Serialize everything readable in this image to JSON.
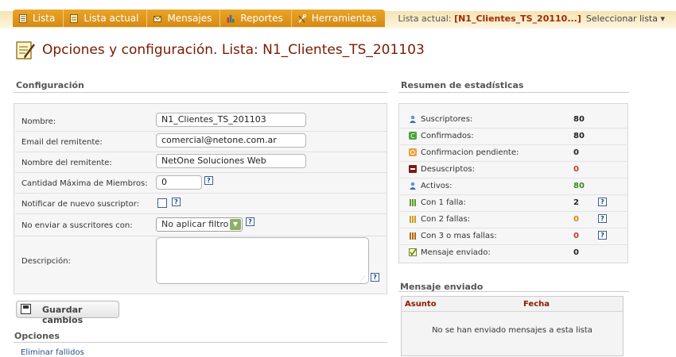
{
  "tabs": [
    {
      "label": "Lista",
      "icon": "list-icon"
    },
    {
      "label": "Lista actual",
      "icon": "document-icon"
    },
    {
      "label": "Mensajes",
      "icon": "envelope-icon"
    },
    {
      "label": "Reportes",
      "icon": "bar-chart-icon"
    },
    {
      "label": "Herramientas",
      "icon": "tools-icon"
    }
  ],
  "topright": {
    "prefix": "Lista actual: ",
    "current": "[N1_Clientes_TS_20110...]",
    "select_label": "Seleccionar lista ▾"
  },
  "page": {
    "title": "Opciones y configuración. Lista: N1_Clientes_TS_201103",
    "title_icon": "document-edit-icon"
  },
  "config": {
    "header": "Configuración",
    "fields": {
      "nombre": {
        "label": "Nombre:",
        "value": "N1_Clientes_TS_201103"
      },
      "email": {
        "label": "Email del remitente:",
        "value": "comercial@netone.com.ar"
      },
      "remitente": {
        "label": "Nombre del remitente:",
        "value": "NetOne Soluciones Web"
      },
      "cantidad": {
        "label": "Cantidad Máxima de Miembros:",
        "value": "0"
      },
      "notificar": {
        "label": "Notificar de nuevo suscriptor:",
        "checked": false
      },
      "no_enviar": {
        "label": "No enviar a suscritores con:",
        "selected": "No aplicar filtro"
      },
      "descripcion": {
        "label": "Descripción:",
        "value": ""
      }
    },
    "save_label": "Guardar cambios",
    "help_glyph": "?"
  },
  "opciones": {
    "header": "Opciones",
    "partial_link": "Eliminar fallidos"
  },
  "stats": {
    "header": "Resumen de estadísticas",
    "rows": [
      {
        "label": "Suscriptores:",
        "value": "80",
        "color": "#222222",
        "icon": "user-icon",
        "help": false
      },
      {
        "label": "Confirmados:",
        "value": "80",
        "color": "#222222",
        "icon": "confirmed-icon",
        "help": false
      },
      {
        "label": "Confirmacion pendiente:",
        "value": "0",
        "color": "#222222",
        "icon": "pending-icon",
        "help": false
      },
      {
        "label": "Desuscriptos:",
        "value": "0",
        "color": "#c0392b",
        "icon": "unsubscribed-icon",
        "help": false
      },
      {
        "label": "Activos:",
        "value": "80",
        "color": "#3a8a1f",
        "icon": "user-active-icon",
        "help": false
      },
      {
        "label": "Con 1 falla:",
        "value": "2",
        "color": "#222222",
        "icon": "fail-1-icon",
        "help": true
      },
      {
        "label": "Con 2 fallas:",
        "value": "0",
        "color": "#d08a10",
        "icon": "fail-2-icon",
        "help": true
      },
      {
        "label": "Con 3 o mas fallas:",
        "value": "0",
        "color": "#c0392b",
        "icon": "fail-3-icon",
        "help": true
      },
      {
        "label": "Mensaje enviado:",
        "value": "0",
        "color": "#222222",
        "icon": "message-sent-icon",
        "help": false
      }
    ]
  },
  "sent": {
    "header": "Mensaje enviado",
    "columns": [
      "Asunto",
      "Fecha"
    ],
    "empty": "No se han enviado mensajes a esta lista"
  },
  "colors": {
    "accent": "#e09a20",
    "title": "#7a1a00",
    "link": "#254e8f"
  }
}
